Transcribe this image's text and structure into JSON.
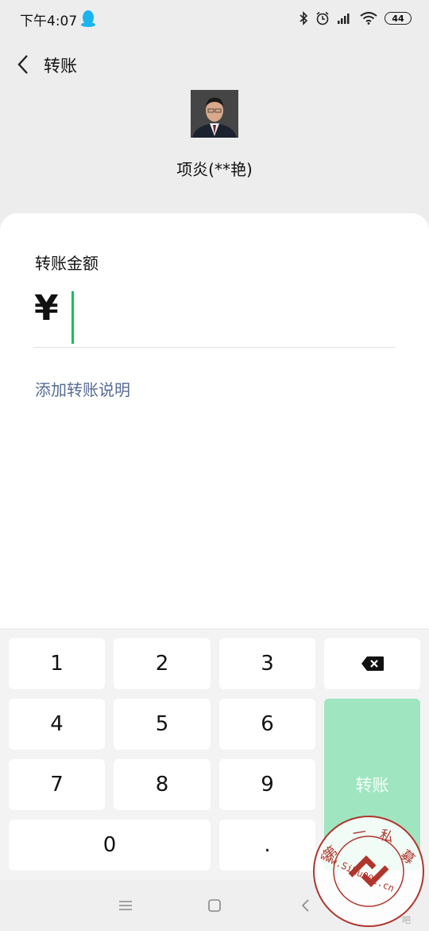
{
  "status_bar": {
    "time": "下午4:07",
    "battery": "44"
  },
  "header": {
    "title": "转账"
  },
  "recipient": {
    "name": "项炎(**艳)"
  },
  "amount": {
    "label": "转账金额",
    "currency": "¥",
    "value": ""
  },
  "note": {
    "link": "添加转账说明"
  },
  "keypad": {
    "keys": [
      "1",
      "2",
      "3",
      "4",
      "5",
      "6",
      "7",
      "8",
      "9",
      "0",
      "."
    ],
    "transfer_label": "转账"
  },
  "watermark": {
    "chars": [
      "第",
      "一",
      "私",
      "募"
    ],
    "url": "www.SiMu001.cn",
    "extra": "吧"
  },
  "colors": {
    "accent_green": "#07c160",
    "transfer_button": "#9fe6c0",
    "link_blue": "#576b95",
    "watermark_red": "#b0352c"
  }
}
